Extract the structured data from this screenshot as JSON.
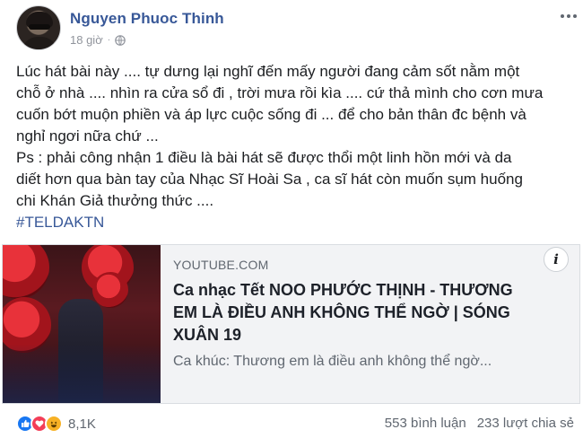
{
  "post": {
    "author": "Nguyen Phuoc Thinh",
    "time": "18 giờ",
    "privacy_icon": "globe-icon",
    "more_icon": "more-options-icon",
    "lines": [
      "Lúc hát bài này .... tự dưng lại nghĩ đến mấy người đang cảm sốt nằm một",
      "chỗ ở nhà .... nhìn ra cửa sổ đi , trời mưa rồi kìa .... cứ thả mình cho cơn mưa",
      "cuốn bớt muộn phiền và áp lực cuộc sống đi ... để cho bản thân đc bệnh và",
      "nghỉ ngơi nữa chứ ...",
      "Ps : phải công nhận 1 điều là bài hát sẽ được thổi một linh hồn mới và da",
      "diết hơn qua bàn tay của Nhạc Sĩ Hoài Sa , ca sĩ hát còn muốn sụm huống",
      "chi Khán Giả thưởng thức ...."
    ],
    "hashtag": "#TELDAKTN"
  },
  "link_card": {
    "source": "YOUTUBE.COM",
    "title_lines": [
      "Ca nhạc Tết NOO PHƯỚC THỊNH - THƯƠNG",
      "EM LÀ ĐIỀU ANH KHÔNG THỂ NGỜ | SÓNG",
      "XUÂN 19"
    ],
    "description": "Ca khúc: Thương em là điều anh không thể ngờ...",
    "info_label": "i"
  },
  "footer": {
    "reactions": [
      "like-icon",
      "love-icon",
      "haha-icon"
    ],
    "reaction_count": "8,1K",
    "comments": "553 bình luận",
    "shares": "233 lượt chia sẻ"
  },
  "colors": {
    "author": "#385898",
    "like": "#1877f2",
    "love": "#f33e58",
    "haha": "#f7b125"
  }
}
